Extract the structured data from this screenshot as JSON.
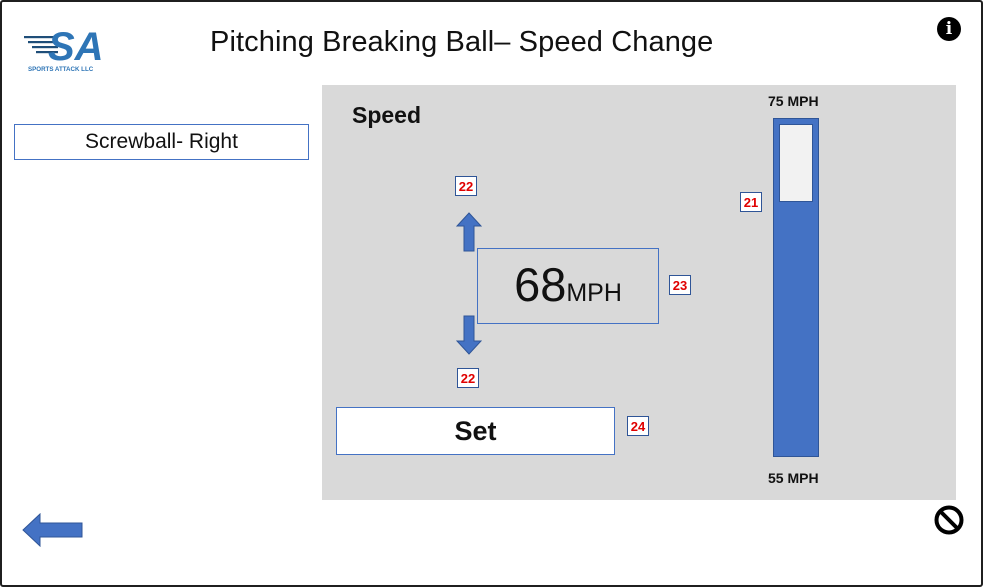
{
  "header": {
    "title": "Pitching Breaking Ball– Speed Change",
    "logo_text": "SA",
    "logo_subtext": "SPORTS ATTACK LLC"
  },
  "icons": {
    "info": "info-icon",
    "info_glyph": "i",
    "back": "back-arrow-icon",
    "cancel": "cancel-icon",
    "speed_up": "arrow-up-icon",
    "speed_down": "arrow-down-icon"
  },
  "pitch_type": {
    "label": "Screwball- Right"
  },
  "speed_panel": {
    "label": "Speed",
    "value": "68",
    "unit": "MPH",
    "set_label": "Set"
  },
  "speed_scale": {
    "max_label": "75 MPH",
    "min_label": "55 MPH",
    "level_fraction": 0.76
  },
  "callouts": {
    "up_arrow": "22",
    "down_arrow": "22",
    "scale": "21",
    "display": "23",
    "set": "24"
  },
  "colors": {
    "accent": "#4472c4",
    "panel": "#d9d9d9",
    "callout_text": "#e00000"
  }
}
